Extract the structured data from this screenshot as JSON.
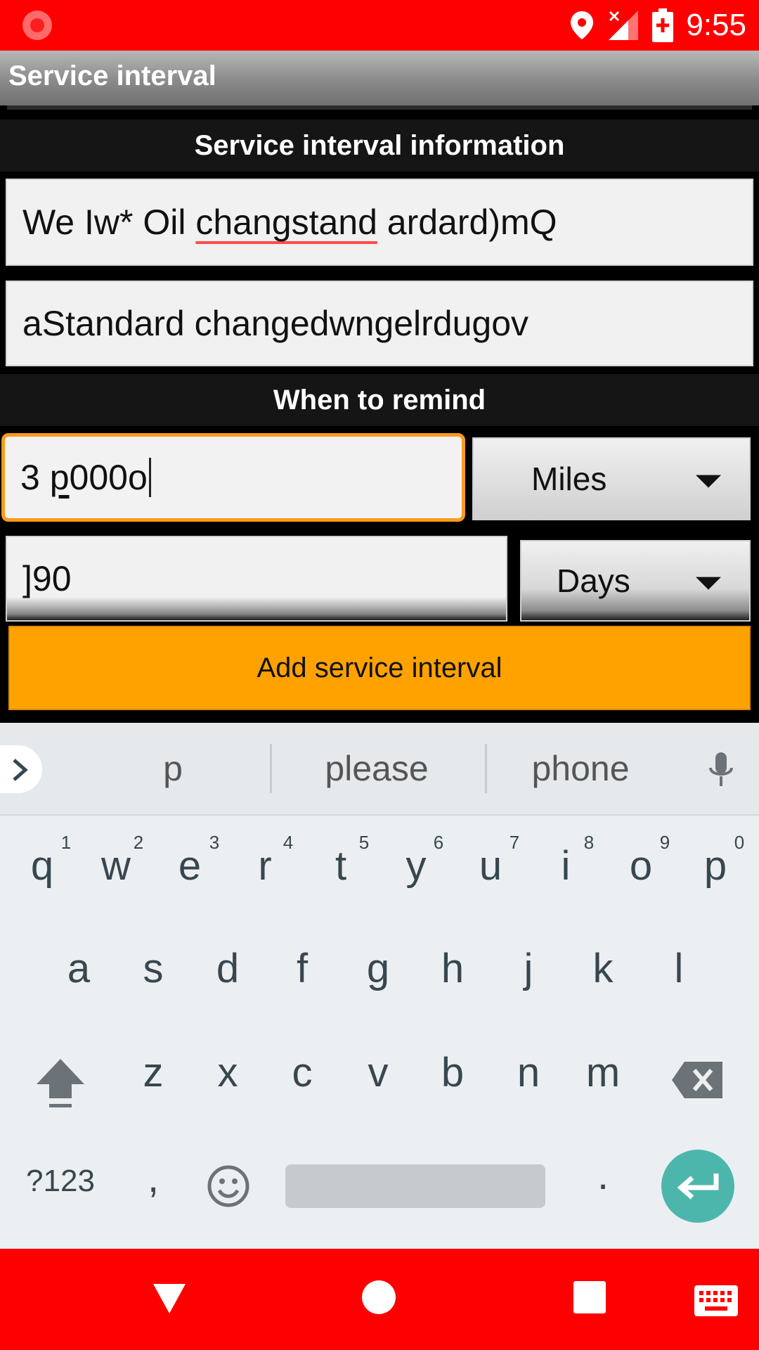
{
  "status_bar": {
    "time": "9:55",
    "icons": [
      "record-icon",
      "location-icon",
      "signal-off-icon",
      "battery-charging-icon"
    ],
    "bg_color": "#ff0000"
  },
  "title_bar": {
    "title": "Service interval"
  },
  "sections": {
    "info_header": "Service interval information",
    "remind_header": "When to remind"
  },
  "form": {
    "name_field": {
      "prefix": "We Iw* Oil ",
      "misspelled": "changstand",
      "suffix": " ardard)mQ"
    },
    "description_field": {
      "value": "aStandard changedwngelrdugov"
    },
    "distance_field": {
      "value_before": "3 ",
      "composing": "p",
      "value_after": "000o"
    },
    "distance_unit": {
      "selected": "Miles"
    },
    "time_field": {
      "value": "]90"
    },
    "time_unit": {
      "selected": "Days"
    },
    "add_button": {
      "label": "Add service interval",
      "color": "#ffa200"
    }
  },
  "keyboard": {
    "suggestions": [
      "p",
      "please",
      "phone"
    ],
    "row1": [
      {
        "key": "q",
        "hint": "1"
      },
      {
        "key": "w",
        "hint": "2"
      },
      {
        "key": "e",
        "hint": "3"
      },
      {
        "key": "r",
        "hint": "4"
      },
      {
        "key": "t",
        "hint": "5"
      },
      {
        "key": "y",
        "hint": "6"
      },
      {
        "key": "u",
        "hint": "7"
      },
      {
        "key": "i",
        "hint": "8"
      },
      {
        "key": "o",
        "hint": "9"
      },
      {
        "key": "p",
        "hint": "0"
      }
    ],
    "row2": [
      "a",
      "s",
      "d",
      "f",
      "g",
      "h",
      "j",
      "k",
      "l"
    ],
    "row3": [
      "z",
      "x",
      "c",
      "v",
      "b",
      "n",
      "m"
    ],
    "symbols_key": "?123",
    "comma_key": ",",
    "period_key": ".",
    "enter_color": "#4db6ac"
  },
  "nav_bar": {
    "icons": [
      "back-icon",
      "home-icon",
      "recents-icon",
      "keyboard-switch-icon"
    ],
    "bg_color": "#ff0000"
  }
}
